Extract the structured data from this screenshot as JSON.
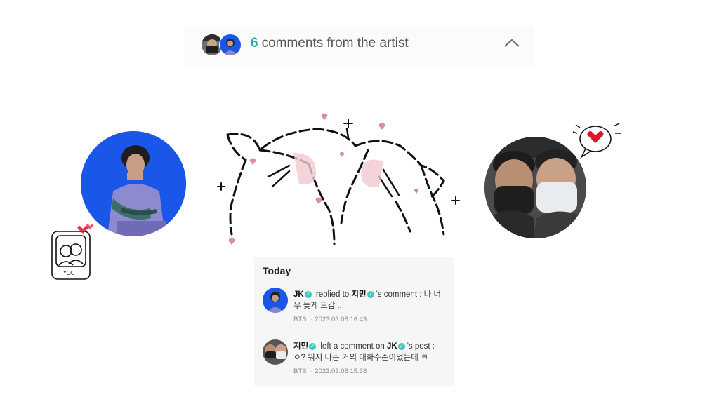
{
  "banner": {
    "count": "6",
    "text": "comments from the artist",
    "chevron": "chevron-up-icon"
  },
  "card": {
    "heading": "Today",
    "items": [
      {
        "author": "JK",
        "action": "replied to",
        "target": "지민",
        "suffix": "'s comment :",
        "content": "나 너무 늦게 드감 ...",
        "group": "BTS",
        "timestamp": "· 2023.03.08 16:43"
      },
      {
        "author": "지민",
        "action": "left a comment on",
        "target": "JK",
        "suffix": "'s post :",
        "content": "ㅇ? 뭐지 나는 거의 대화수준이었는데 ㅋ",
        "group": "BTS",
        "timestamp": "· 2023.03.08 15:38"
      }
    ]
  },
  "doodle": {
    "label": "YOU"
  },
  "colors": {
    "accent": "#2aa9a2",
    "verified": "#3cc7c0",
    "heart_pink": "#d98ea0",
    "heart_red": "#e0142b",
    "avatar_blue": "#1a56e8"
  }
}
